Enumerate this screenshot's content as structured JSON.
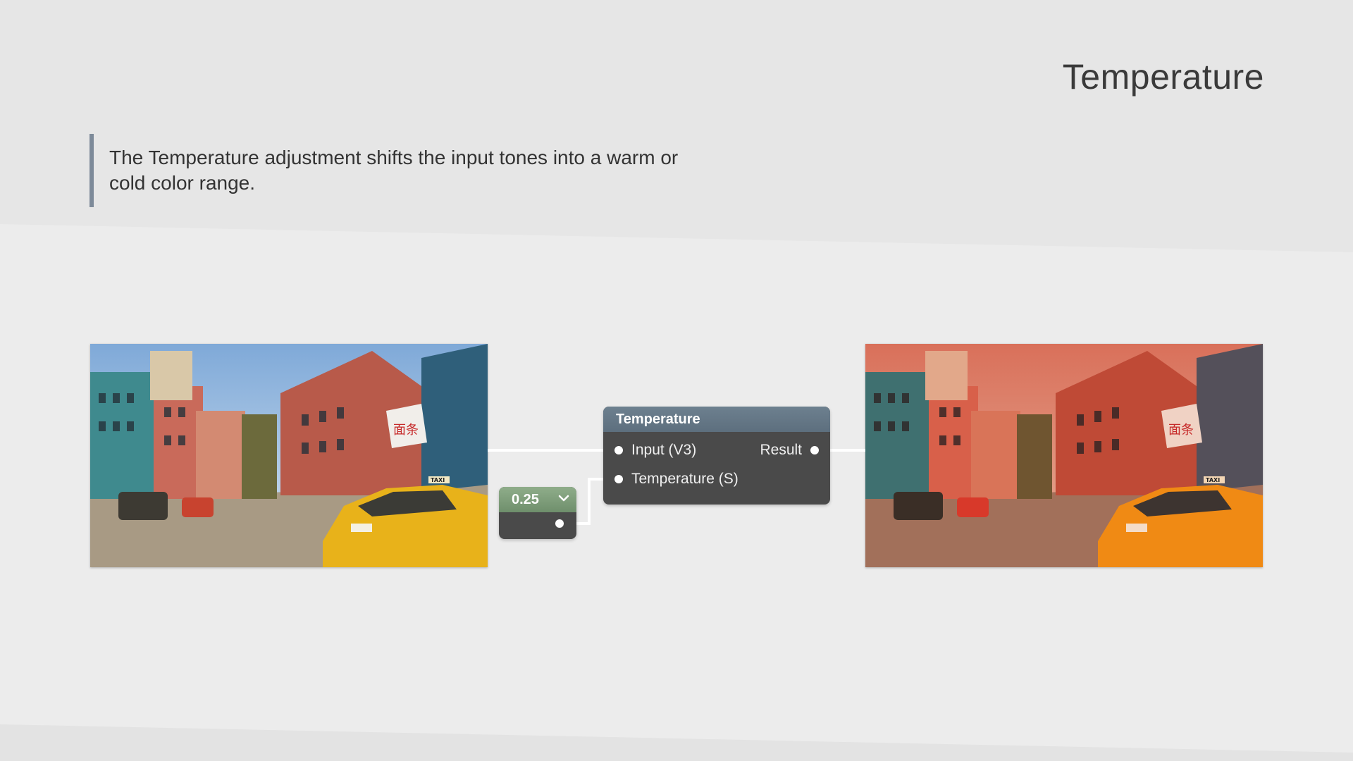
{
  "page": {
    "title": "Temperature",
    "description": "The Temperature adjustment shifts the input tones into a warm or cold color range."
  },
  "node": {
    "title": "Temperature",
    "inputs": [
      "Input (V3)",
      "Temperature (S)"
    ],
    "output": "Result",
    "header_color": "#607282",
    "body_color": "#4a4a4a"
  },
  "value_node": {
    "value": "0.25",
    "header_color": "#7f9e7b",
    "dropdown_icon": "chevron-down-icon"
  },
  "scenes": {
    "input_icon": "city-street-image",
    "output_icon": "city-street-warm-image",
    "shop_sign": "面条",
    "taxi_sign": "TAXI"
  },
  "colors": {
    "accent_bar": "#7d8a99",
    "wire": "#ffffff"
  }
}
